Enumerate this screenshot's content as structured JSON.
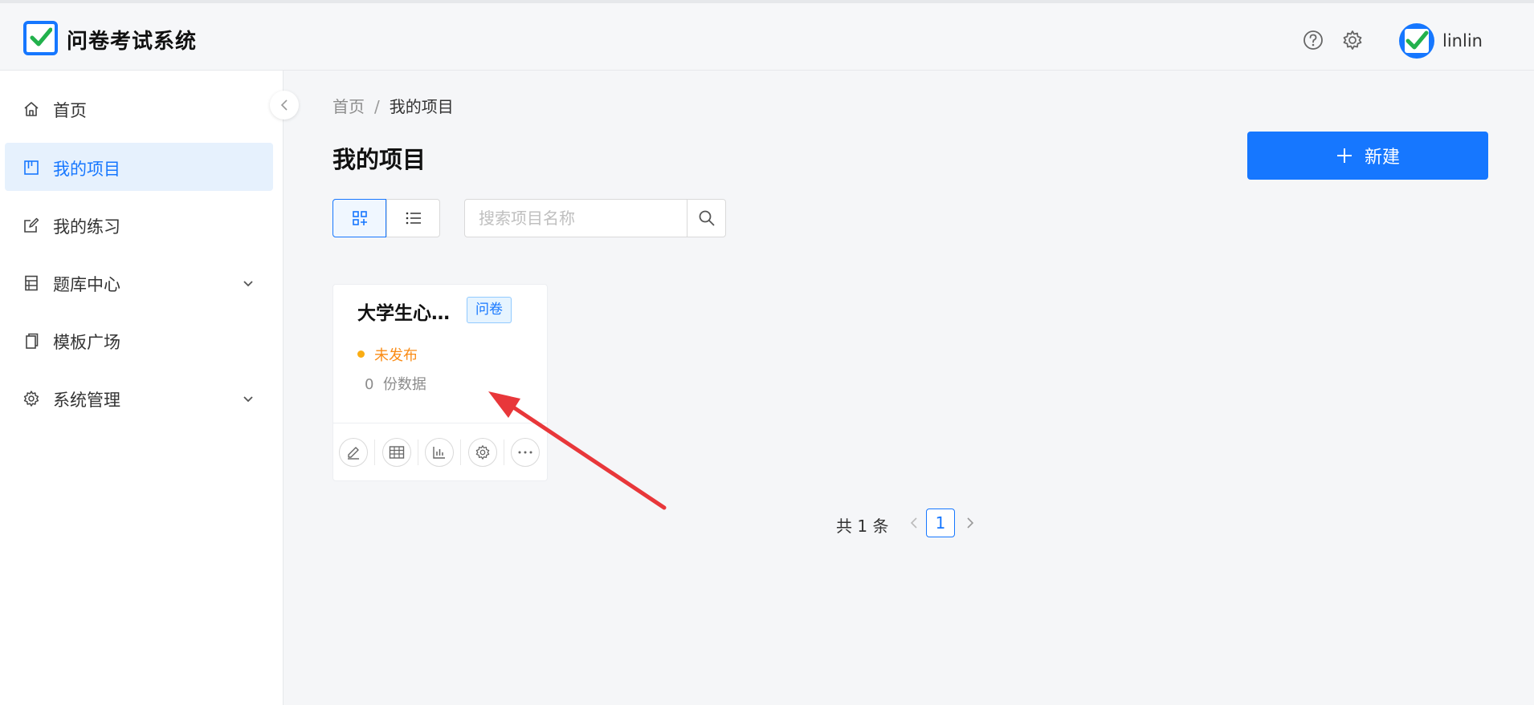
{
  "app": {
    "title": "问卷考试系统"
  },
  "header": {
    "username": "linlin"
  },
  "sidebar": {
    "items": [
      {
        "label": "首页",
        "icon": "home-icon"
      },
      {
        "label": "我的项目",
        "icon": "project-board-icon",
        "active": true
      },
      {
        "label": "我的练习",
        "icon": "edit-note-icon"
      },
      {
        "label": "题库中心",
        "icon": "question-bank-icon",
        "expandable": true
      },
      {
        "label": "模板广场",
        "icon": "template-copy-icon"
      },
      {
        "label": "系统管理",
        "icon": "gear-icon",
        "expandable": true
      }
    ]
  },
  "breadcrumb": {
    "home": "首页",
    "separator": "/",
    "current": "我的项目"
  },
  "main": {
    "title": "我的项目",
    "new_button": "新建",
    "search": {
      "placeholder": "搜索项目名称",
      "value": ""
    }
  },
  "cards": [
    {
      "title": "大学生心理健康调查问卷",
      "tag": "问卷",
      "status": "未发布",
      "count": "0",
      "count_label": "份数据"
    }
  ],
  "pagination": {
    "total": "共 1 条",
    "current": "1"
  },
  "colors": {
    "accent": "#1677ff",
    "status_unpublished": "#fa8c16",
    "annotation_arrow": "#e8373a"
  }
}
